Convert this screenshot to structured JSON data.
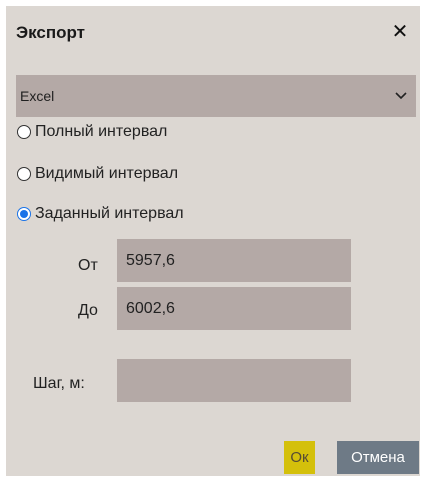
{
  "dialog": {
    "title": "Экспорт",
    "close_icon": "close-icon"
  },
  "format": {
    "selected": "Excel",
    "icon": "chevron-down-icon"
  },
  "interval_options": [
    {
      "label": "Полный интервал",
      "checked": false
    },
    {
      "label": "Видимый интервал",
      "checked": false
    },
    {
      "label": "Заданный интервал",
      "checked": true
    }
  ],
  "fields": {
    "from_label": "От",
    "from_value": "5957,6",
    "to_label": "До",
    "to_value": "6002,6",
    "step_label": "Шаг, м:",
    "step_value": ""
  },
  "buttons": {
    "ok": "Ок",
    "cancel": "Отмена"
  },
  "colors": {
    "dialog_bg": "#dcd7d2",
    "field_bg": "#b4a9a6",
    "ok_bg": "#d4c00b",
    "cancel_bg": "#6e7a86",
    "radio_accent": "#1a73e8"
  }
}
